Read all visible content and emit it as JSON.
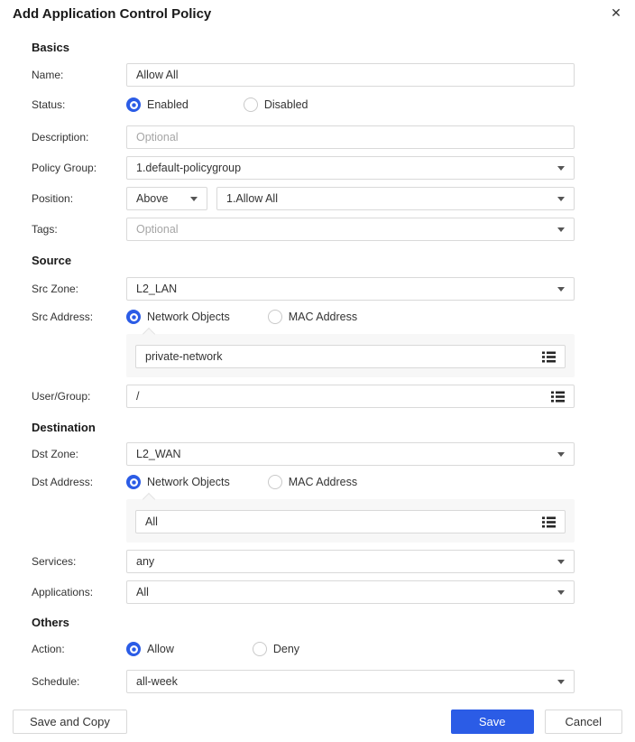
{
  "header": {
    "title": "Add Application Control Policy",
    "close_icon": "✕"
  },
  "basics": {
    "section_title": "Basics",
    "name": {
      "label": "Name:",
      "value": "Allow All"
    },
    "status": {
      "label": "Status:",
      "options": [
        {
          "label": "Enabled",
          "selected": true
        },
        {
          "label": "Disabled",
          "selected": false
        }
      ]
    },
    "description": {
      "label": "Description:",
      "placeholder": "Optional"
    },
    "policy_group": {
      "label": "Policy Group:",
      "value": "1.default-policygroup"
    },
    "position": {
      "label": "Position:",
      "relation_value": "Above",
      "anchor_value": "1.Allow All"
    },
    "tags": {
      "label": "Tags:",
      "placeholder": "Optional"
    }
  },
  "source": {
    "section_title": "Source",
    "src_zone": {
      "label": "Src Zone:",
      "value": "L2_LAN"
    },
    "src_address": {
      "label": "Src Address:",
      "options": [
        {
          "label": "Network Objects",
          "selected": true
        },
        {
          "label": "MAC Address",
          "selected": false
        }
      ],
      "network_objects_value": "private-network"
    },
    "user_group": {
      "label": "User/Group:",
      "value": "/"
    }
  },
  "destination": {
    "section_title": "Destination",
    "dst_zone": {
      "label": "Dst Zone:",
      "value": "L2_WAN"
    },
    "dst_address": {
      "label": "Dst Address:",
      "options": [
        {
          "label": "Network Objects",
          "selected": true
        },
        {
          "label": "MAC Address",
          "selected": false
        }
      ],
      "network_objects_value": "All"
    },
    "services": {
      "label": "Services:",
      "value": "any"
    },
    "applications": {
      "label": "Applications:",
      "value": "All"
    }
  },
  "others": {
    "section_title": "Others",
    "action": {
      "label": "Action:",
      "options": [
        {
          "label": "Allow",
          "selected": true
        },
        {
          "label": "Deny",
          "selected": false
        }
      ]
    },
    "schedule": {
      "label": "Schedule:",
      "value": "all-week"
    }
  },
  "footer": {
    "save_and_copy": "Save and Copy",
    "save": "Save",
    "cancel": "Cancel"
  },
  "colors": {
    "accent_blue": "#2b5ce6",
    "border": "#d9d9d9",
    "panel_bg": "#f7f7f7",
    "text": "#333333",
    "placeholder": "#a6a6a6"
  }
}
